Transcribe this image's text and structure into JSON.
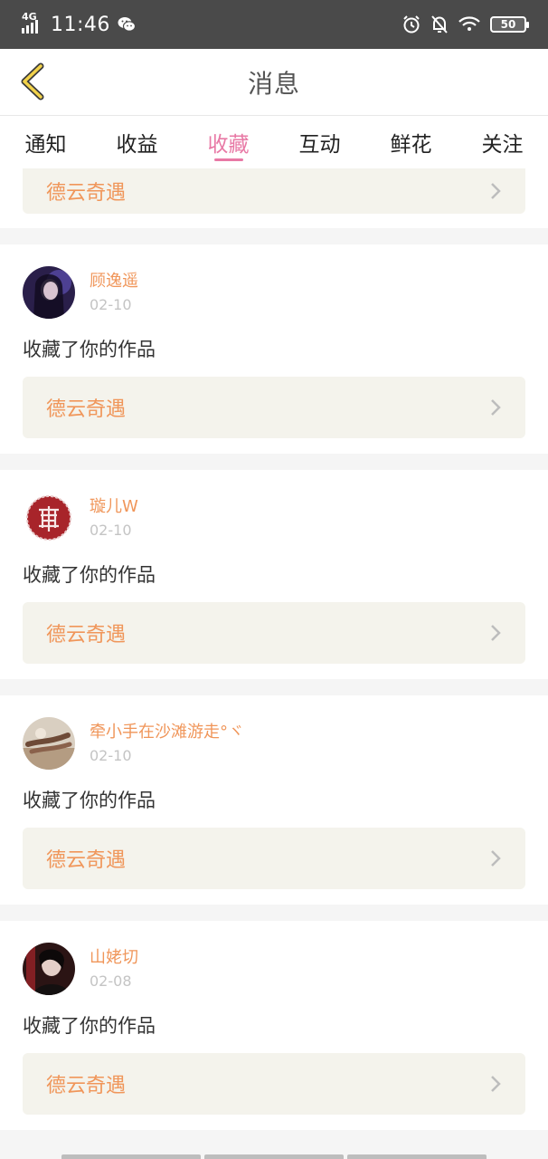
{
  "status_bar": {
    "network": "4G",
    "time": "11:46",
    "battery": "50"
  },
  "header": {
    "title": "消息"
  },
  "tabs": [
    {
      "label": "通知",
      "active": false
    },
    {
      "label": "收益",
      "active": false
    },
    {
      "label": "收藏",
      "active": true
    },
    {
      "label": "互动",
      "active": false
    },
    {
      "label": "鲜花",
      "active": false
    },
    {
      "label": "关注",
      "active": false
    }
  ],
  "partial_item": {
    "work_title": "德云奇遇"
  },
  "items": [
    {
      "user": "顾逸遥",
      "date": "02-10",
      "action": "收藏了你的作品",
      "work_title": "德云奇遇"
    },
    {
      "user": "璇儿W",
      "date": "02-10",
      "action": "收藏了你的作品",
      "work_title": "德云奇遇"
    },
    {
      "user": "牵小手在沙滩游走°ヾ",
      "date": "02-10",
      "action": "收藏了你的作品",
      "work_title": "德云奇遇"
    },
    {
      "user": "山姥切",
      "date": "02-08",
      "action": "收藏了你的作品",
      "work_title": "德云奇遇"
    }
  ],
  "colors": {
    "accent": "#e879a5",
    "username": "#f0965a",
    "work_bg": "#f4f3ec",
    "status_bar": "#4a4a4a"
  }
}
